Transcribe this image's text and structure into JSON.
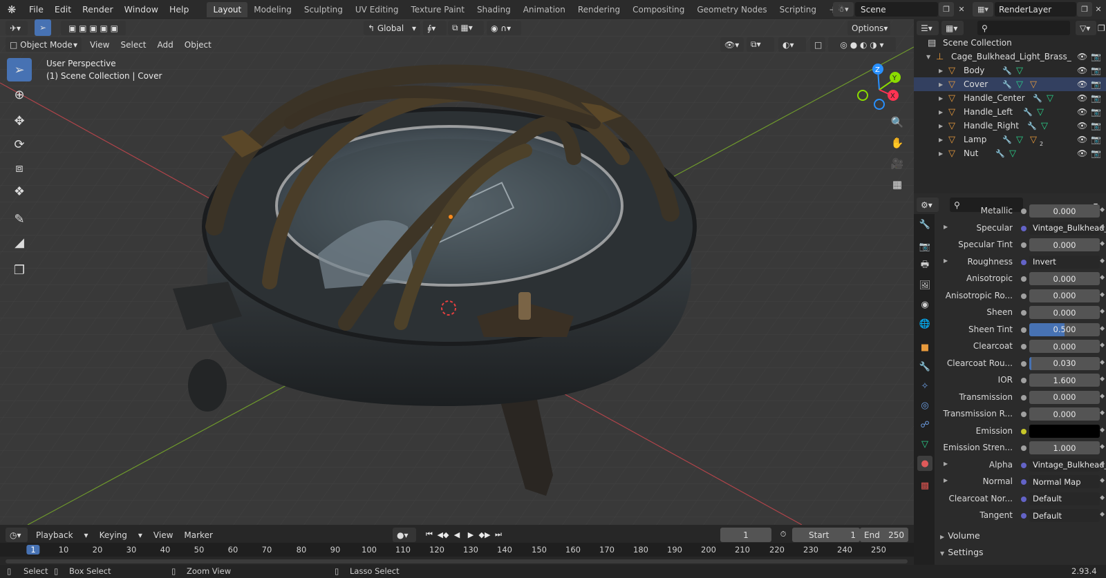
{
  "menus": [
    "File",
    "Edit",
    "Render",
    "Window",
    "Help"
  ],
  "workspaces": [
    "Layout",
    "Modeling",
    "Sculpting",
    "UV Editing",
    "Texture Paint",
    "Shading",
    "Animation",
    "Rendering",
    "Compositing",
    "Geometry Nodes",
    "Scripting"
  ],
  "active_workspace": "Layout",
  "scene_name": "Scene",
  "view_layer": "RenderLayer",
  "viewport": {
    "mode": "Object Mode",
    "menu": [
      "View",
      "Select",
      "Add",
      "Object"
    ],
    "transform_orientation": "Global",
    "options_label": "Options",
    "perspective_label": "User Perspective",
    "collection_label": "(1) Scene Collection | Cover",
    "gizmo_axes": [
      "Z",
      "Y",
      "X"
    ]
  },
  "timeline": {
    "menu": [
      "Playback",
      "Keying",
      "View",
      "Marker"
    ],
    "current_frame": "1",
    "start_label": "Start",
    "start_value": "1",
    "end_label": "End",
    "end_value": "250",
    "ruler_current": "1",
    "ruler_ticks": [
      "10",
      "20",
      "30",
      "40",
      "50",
      "60",
      "70",
      "80",
      "90",
      "100",
      "110",
      "120",
      "130",
      "140",
      "150",
      "160",
      "170",
      "180",
      "190",
      "200",
      "210",
      "220",
      "230",
      "240",
      "250"
    ]
  },
  "status_bar": {
    "select": "Select",
    "box_select": "Box Select",
    "zoom_view": "Zoom View",
    "lasso_select": "Lasso Select",
    "version": "2.93.4"
  },
  "outliner": {
    "root": "Scene Collection",
    "collection": "Cage_Bulkhead_Light_Brass_",
    "objects": [
      "Body",
      "Cover",
      "Handle_Center",
      "Handle_Left",
      "Handle_Right",
      "Lamp",
      "Nut"
    ],
    "lamp_material_count": "2"
  },
  "properties": {
    "rows": [
      {
        "label": "Metallic",
        "value": "0.000",
        "type": "number",
        "dot": "grey",
        "expander": false,
        "fill": 0
      },
      {
        "label": "Specular",
        "value": "Vintage_Bulkhead_...",
        "type": "link",
        "dot": "blue",
        "expander": true,
        "fill": 0
      },
      {
        "label": "Specular Tint",
        "value": "0.000",
        "type": "number",
        "dot": "grey",
        "expander": false,
        "fill": 0
      },
      {
        "label": "Roughness",
        "value": "Invert",
        "type": "link",
        "dot": "blue",
        "expander": true,
        "fill": 0
      },
      {
        "label": "Anisotropic",
        "value": "0.000",
        "type": "number",
        "dot": "grey",
        "expander": false,
        "fill": 0
      },
      {
        "label": "Anisotropic Ro...",
        "value": "0.000",
        "type": "number",
        "dot": "grey",
        "expander": false,
        "fill": 0
      },
      {
        "label": "Sheen",
        "value": "0.000",
        "type": "number",
        "dot": "grey",
        "expander": false,
        "fill": 0
      },
      {
        "label": "Sheen Tint",
        "value": "0.500",
        "type": "number",
        "dot": "grey",
        "expander": false,
        "fill": 0.5
      },
      {
        "label": "Clearcoat",
        "value": "0.000",
        "type": "number",
        "dot": "grey",
        "expander": false,
        "fill": 0
      },
      {
        "label": "Clearcoat Rou...",
        "value": "0.030",
        "type": "number",
        "dot": "grey",
        "expander": false,
        "fill": 0.03
      },
      {
        "label": "IOR",
        "value": "1.600",
        "type": "number",
        "dot": "grey",
        "expander": false,
        "fill": 0
      },
      {
        "label": "Transmission",
        "value": "0.000",
        "type": "number",
        "dot": "grey",
        "expander": false,
        "fill": 0
      },
      {
        "label": "Transmission R...",
        "value": "0.000",
        "type": "number",
        "dot": "grey",
        "expander": false,
        "fill": 0
      },
      {
        "label": "Emission",
        "value": "",
        "type": "color",
        "dot": "yellow",
        "expander": false,
        "fill": 0
      },
      {
        "label": "Emission Stren...",
        "value": "1.000",
        "type": "number",
        "dot": "grey",
        "expander": false,
        "fill": 0
      },
      {
        "label": "Alpha",
        "value": "Vintage_Bulkhead_...",
        "type": "link",
        "dot": "blue",
        "expander": true,
        "fill": 0
      },
      {
        "label": "Normal",
        "value": "Normal Map",
        "type": "link",
        "dot": "purple",
        "expander": true,
        "fill": 0
      },
      {
        "label": "Clearcoat Nor...",
        "value": "Default",
        "type": "link",
        "dot": "purple",
        "expander": false,
        "fill": 0
      },
      {
        "label": "Tangent",
        "value": "Default",
        "type": "link",
        "dot": "purple",
        "expander": false,
        "fill": 0
      }
    ],
    "sections": [
      "Volume",
      "Settings"
    ]
  },
  "colors": {
    "accent": "#4772b3",
    "emission": "#000000",
    "x_axis": "#ff3352",
    "y_axis": "#8bdc00",
    "z_axis": "#2890ff",
    "link_dot": "#6363c7",
    "yellow_dot": "#c7c729"
  }
}
